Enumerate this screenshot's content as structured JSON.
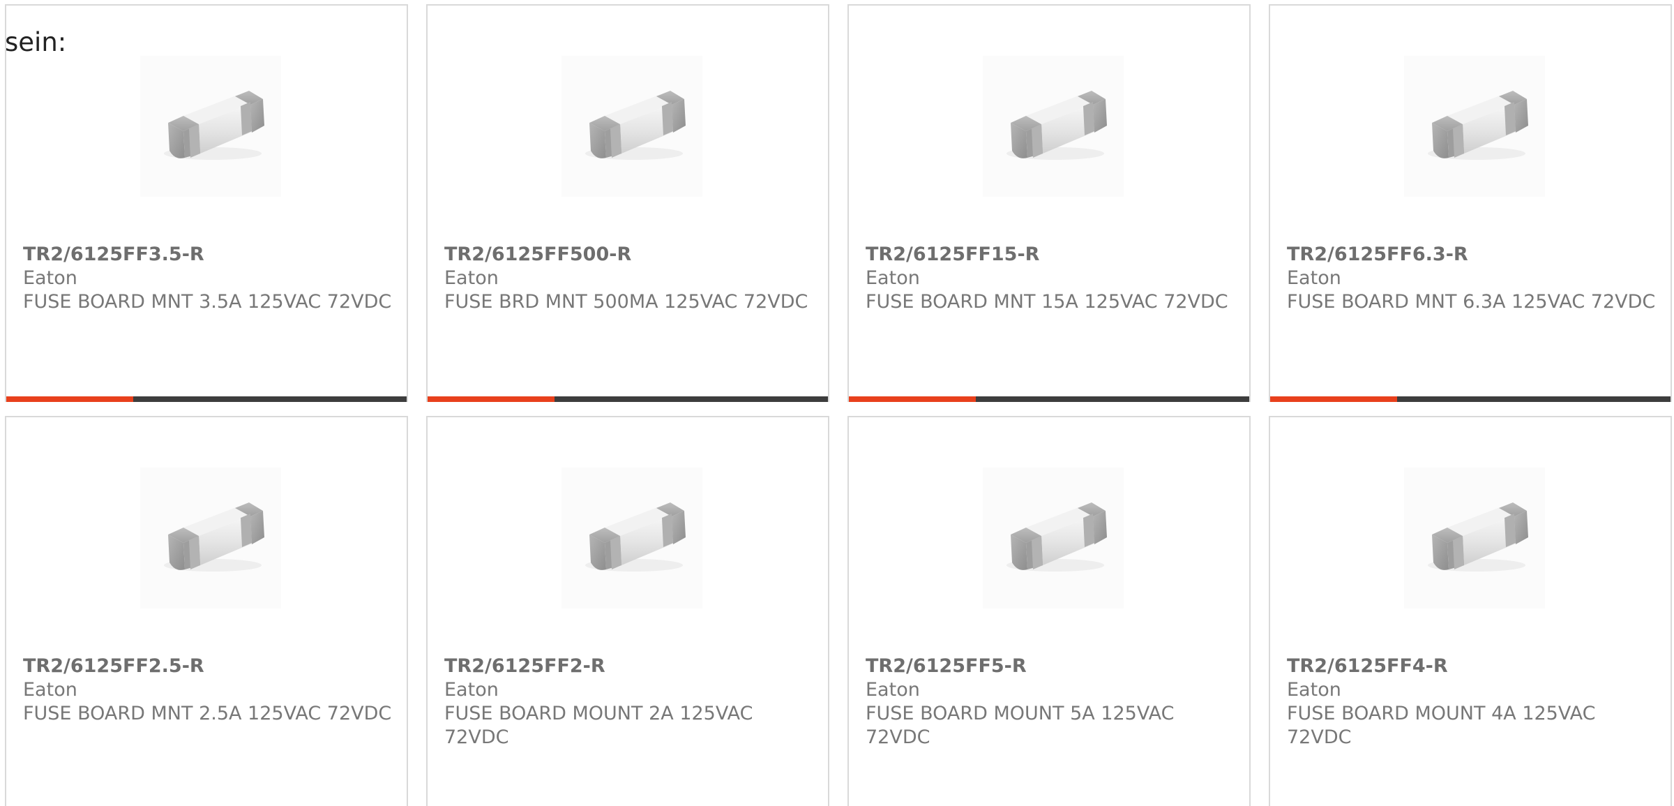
{
  "intro_text": "sein:",
  "colors": {
    "accent": "#e8401c",
    "bar_dark": "#3d3d3d",
    "border": "#d9d9d9",
    "text": "#777777"
  },
  "products": [
    {
      "part_number": "TR2/6125FF3.5-R",
      "manufacturer": "Eaton",
      "description": "FUSE BOARD MNT 3.5A 125VAC 72VDC",
      "image_icon": "smd-fuse-image"
    },
    {
      "part_number": "TR2/6125FF500-R",
      "manufacturer": "Eaton",
      "description": "FUSE BRD MNT 500MA 125VAC 72VDC",
      "image_icon": "smd-fuse-image"
    },
    {
      "part_number": "TR2/6125FF15-R",
      "manufacturer": "Eaton",
      "description": "FUSE BOARD MNT 15A 125VAC 72VDC",
      "image_icon": "smd-fuse-image"
    },
    {
      "part_number": "TR2/6125FF6.3-R",
      "manufacturer": "Eaton",
      "description": "FUSE BOARD MNT 6.3A 125VAC 72VDC",
      "image_icon": "smd-fuse-image"
    },
    {
      "part_number": "TR2/6125FF2.5-R",
      "manufacturer": "Eaton",
      "description": "FUSE BOARD MNT 2.5A 125VAC 72VDC",
      "image_icon": "smd-fuse-image"
    },
    {
      "part_number": "TR2/6125FF2-R",
      "manufacturer": "Eaton",
      "description": "FUSE BOARD MOUNT 2A 125VAC 72VDC",
      "image_icon": "smd-fuse-image"
    },
    {
      "part_number": "TR2/6125FF5-R",
      "manufacturer": "Eaton",
      "description": "FUSE BOARD MOUNT 5A 125VAC 72VDC",
      "image_icon": "smd-fuse-image"
    },
    {
      "part_number": "TR2/6125FF4-R",
      "manufacturer": "Eaton",
      "description": "FUSE BOARD MOUNT 4A 125VAC 72VDC",
      "image_icon": "smd-fuse-image"
    }
  ]
}
